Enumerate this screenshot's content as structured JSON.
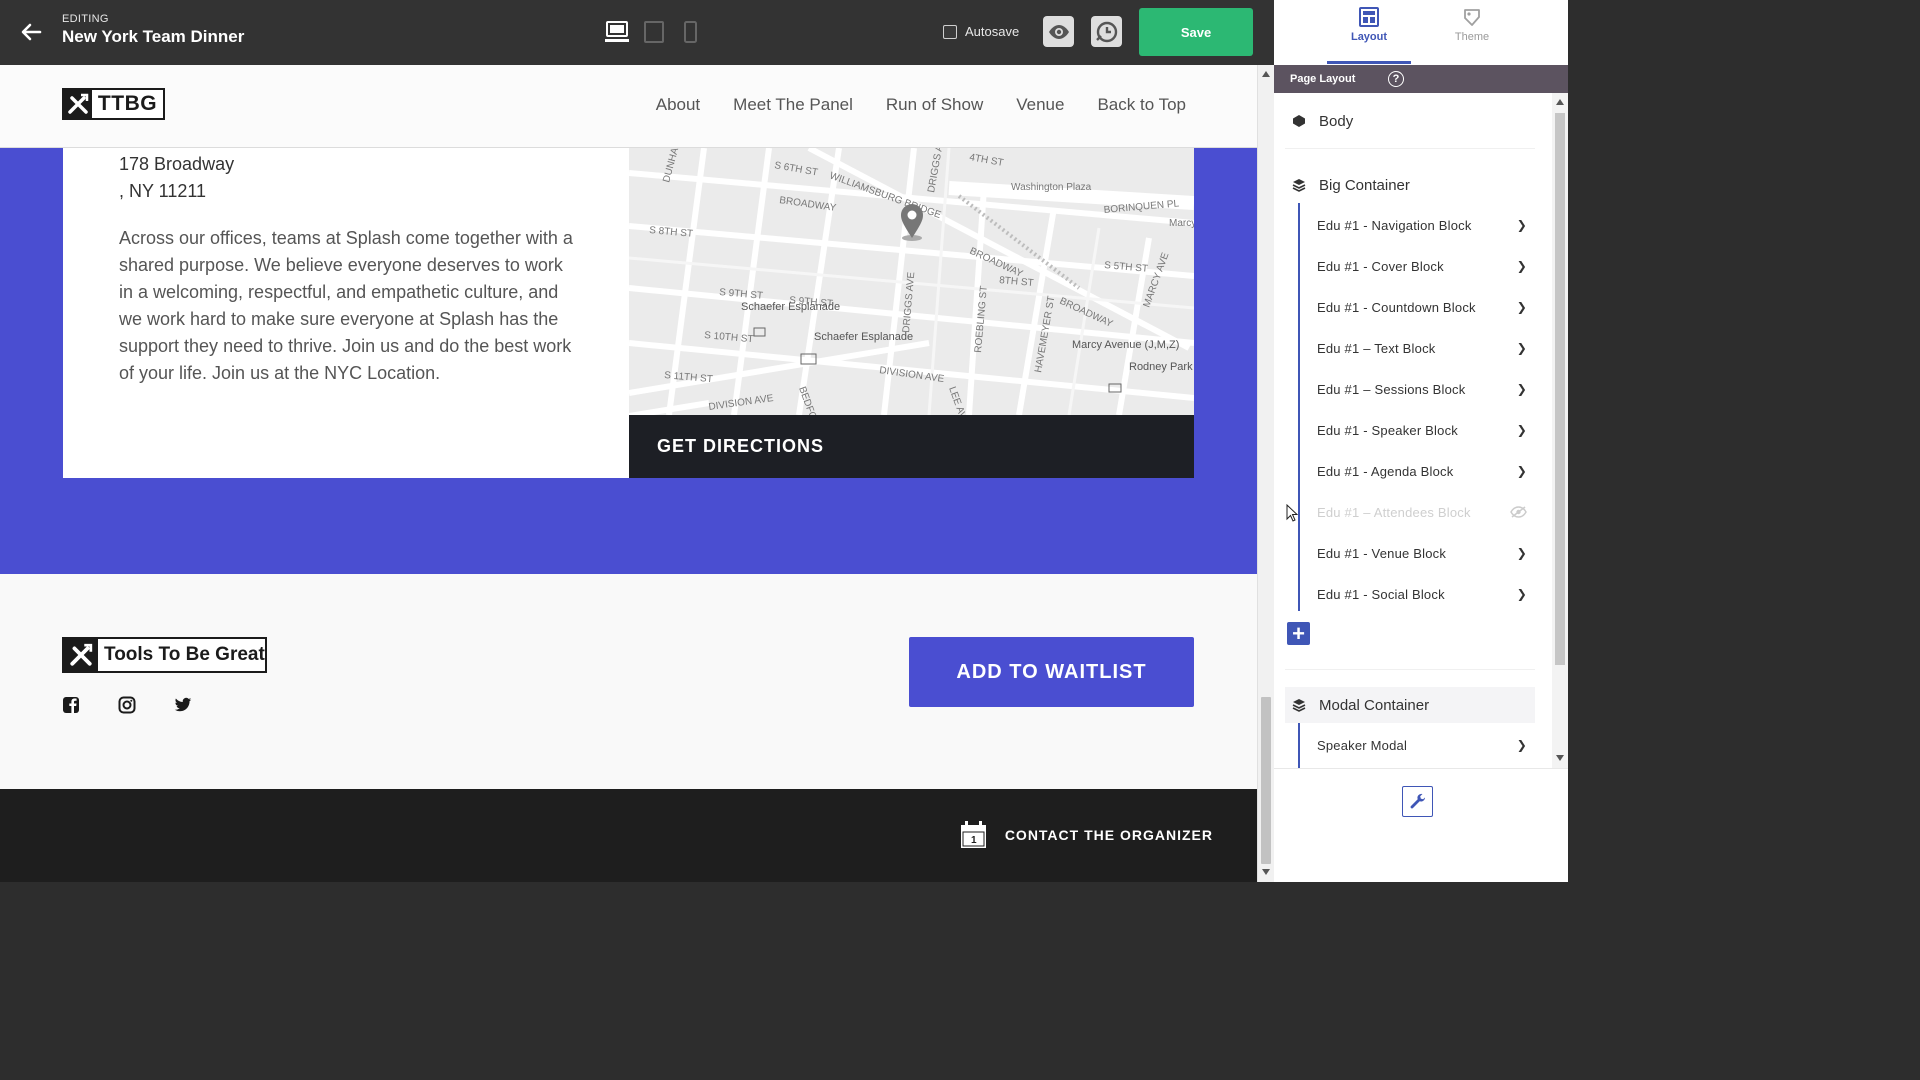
{
  "editor": {
    "editing_label": "EDITING",
    "event_title": "New York Team Dinner",
    "autosave_label": "Autosave",
    "autosave_checked": false,
    "save_label": "Save",
    "active_device": "desktop"
  },
  "site": {
    "logo_text": "TTBG",
    "nav": [
      "About",
      "Meet The Panel",
      "Run of Show",
      "Venue",
      "Back to Top"
    ],
    "venue": {
      "address_line1": "178 Broadway",
      "address_line2": ", NY 11211",
      "description": "Across our offices, teams at Splash come together with a shared purpose. We believe everyone deserves to work in a welcoming, respectful, and empathetic culture, and we work hard to make sure everyone at Splash has the support they need to thrive. Join us and do the best work of your life. Join us at the NYC Location.",
      "directions_label": "GET DIRECTIONS"
    },
    "map_labels": {
      "williamsburg_bridge": "WILLIAMSBURG BRIDGE",
      "broadway_1": "BROADWAY",
      "broadway_2": "BROADWAY",
      "broadway_3": "BROADWAY",
      "washington_plaza": "Washington Plaza",
      "borinquen": "BORINQUEN PL",
      "marcy_nor": "Marcy Nor",
      "s8th": "S 8TH ST",
      "s9th": "S 9TH ST",
      "s9th_b": "S 9TH ST",
      "s10th": "S 10TH ST",
      "s11th": "S 11TH ST",
      "s5th": "S 5TH ST",
      "s8th_b": "8TH ST",
      "s6th": "S 6TH ST",
      "s4th": "4TH ST",
      "driggs": "DRIGGS AVE",
      "driggs_b": "DRIGGS AVE",
      "roebling": "ROEBLING ST",
      "havemeyer": "HAVEMEYER ST",
      "division": "DIVISION AVE",
      "division_b": "DIVISION AVE",
      "schaefer_1": "Schaefer Esplanade",
      "schaefer_2": "Schaefer Esplanade",
      "marcy_avenue": "Marcy Avenue (J,M,Z)",
      "rodney_park": "Rodney Park South",
      "marcy_ave": "MARCY AVE",
      "dunham": "DUNHA",
      "bedford": "BEDFOR",
      "lee_ave": "LEE AVE"
    },
    "footer": {
      "logo_text": "Tools To Be Great",
      "social_icons": [
        "facebook-icon",
        "instagram-icon",
        "twitter-icon"
      ],
      "waitlist_label": "ADD TO WAITLIST",
      "contact_label": "CONTACT THE ORGANIZER",
      "calendar_day": "1"
    }
  },
  "panel": {
    "tabs": [
      {
        "label": "Layout",
        "active": true
      },
      {
        "label": "Theme",
        "active": false
      }
    ],
    "section_title": "Page Layout",
    "help": "?",
    "body_label": "Body",
    "big_container_label": "Big Container",
    "blocks": [
      {
        "label": "Edu #1 - Navigation Block",
        "hidden": false
      },
      {
        "label": "Edu #1 - Cover Block",
        "hidden": false
      },
      {
        "label": "Edu #1 - Countdown Block",
        "hidden": false
      },
      {
        "label": "Edu #1 – Text Block",
        "hidden": false
      },
      {
        "label": "Edu #1 – Sessions Block",
        "hidden": false
      },
      {
        "label": "Edu #1 - Speaker Block",
        "hidden": false
      },
      {
        "label": "Edu #1 - Agenda Block",
        "hidden": false
      },
      {
        "label": "Edu #1 – Attendees Block",
        "hidden": true
      },
      {
        "label": "Edu #1 - Venue Block",
        "hidden": false
      },
      {
        "label": "Edu #1 - Social Block",
        "hidden": false
      }
    ],
    "modal_container_label": "Modal Container",
    "modal_items": [
      {
        "label": "Speaker Modal",
        "hidden": false
      }
    ]
  },
  "colors": {
    "brand_primary": "#4a4ed1",
    "save_green": "#2cb873",
    "panel_accent": "#3f56b6",
    "topbar": "#333333"
  }
}
